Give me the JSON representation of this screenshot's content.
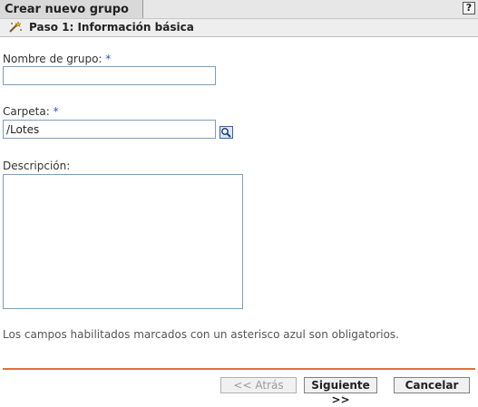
{
  "window": {
    "title": "Crear nuevo grupo",
    "help_label": "?"
  },
  "step": {
    "icon": "wand-icon",
    "label": "Paso 1: Información básica"
  },
  "form": {
    "group_name": {
      "label": "Nombre de grupo:",
      "required_mark": "*",
      "value": ""
    },
    "folder": {
      "label": "Carpeta:",
      "required_mark": "*",
      "value": "/Lotes",
      "browse_icon": "search-icon"
    },
    "description": {
      "label": "Descripción:",
      "value": ""
    }
  },
  "note": "Los campos habilitados marcados con un asterisco azul son obligatorios.",
  "buttons": {
    "back": "<< Atrás",
    "next": "Siguiente >>",
    "cancel": "Cancelar"
  },
  "colors": {
    "required_asterisk": "#2a55c0",
    "divider": "#e2703a",
    "input_border": "#7f9db9"
  }
}
